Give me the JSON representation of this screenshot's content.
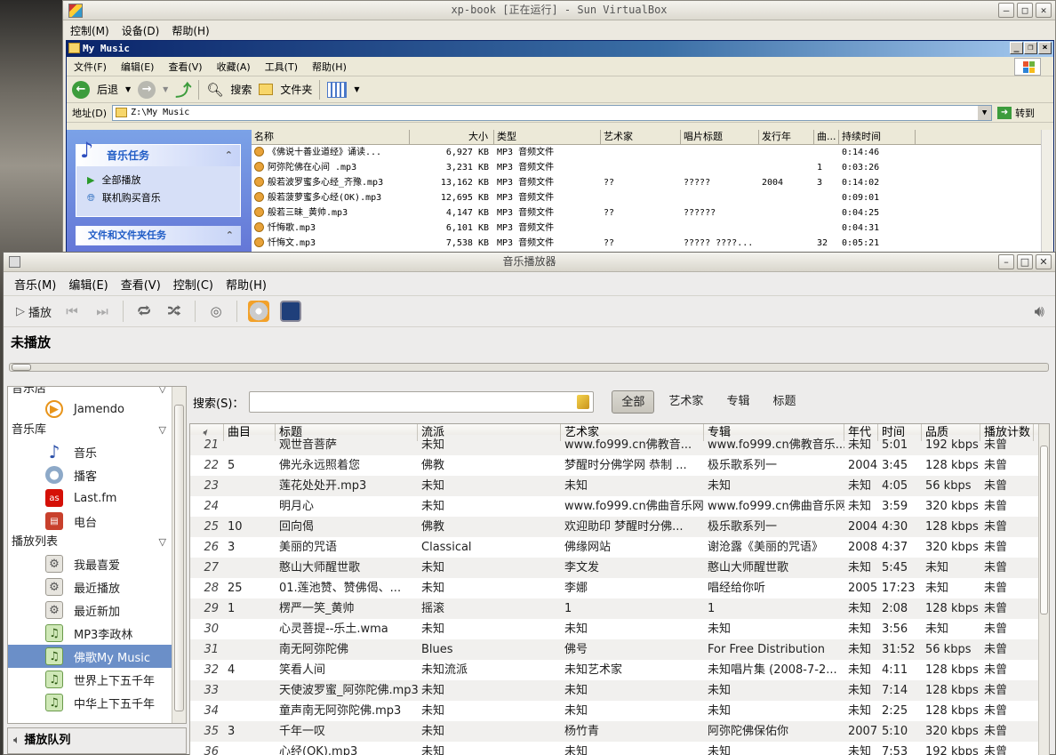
{
  "vbox": {
    "title": "xp-book [正在运行] - Sun VirtualBox",
    "menu": [
      "控制(M)",
      "设备(D)",
      "帮助(H)"
    ]
  },
  "xp": {
    "title": "My Music",
    "menu": [
      "文件(F)",
      "编辑(E)",
      "查看(V)",
      "收藏(A)",
      "工具(T)",
      "帮助(H)"
    ],
    "toolbar": {
      "back": "后退",
      "search": "搜索",
      "folders": "文件夹"
    },
    "address_label": "地址(D)",
    "address": "Z:\\My Music",
    "go": "转到",
    "tasks": {
      "title": "音乐任务",
      "items": [
        "全部播放",
        "联机购买音乐"
      ],
      "file_tasks": "文件和文件夹任务"
    },
    "columns": [
      "名称",
      "大小",
      "类型",
      "艺术家",
      "唱片标题",
      "发行年",
      "曲...",
      "持续时间"
    ],
    "files": [
      {
        "name": "《佛说十善业道经》诵读...",
        "size": "6,927 KB",
        "type": "MP3 音频文件",
        "artist": "",
        "album": "",
        "year": "",
        "track": "",
        "duration": "0:14:46"
      },
      {
        "name": "阿弥陀佛在心间 .mp3",
        "size": "3,231 KB",
        "type": "MP3 音频文件",
        "artist": "",
        "album": "",
        "year": "",
        "track": "1",
        "duration": "0:03:26"
      },
      {
        "name": "般若波罗蜜多心经_齐豫.mp3",
        "size": "13,162 KB",
        "type": "MP3 音频文件",
        "artist": "??",
        "album": "?????",
        "year": "2004",
        "track": "3",
        "duration": "0:14:02"
      },
      {
        "name": "般若菠萝蜜多心经(OK).mp3",
        "size": "12,695 KB",
        "type": "MP3 音频文件",
        "artist": "",
        "album": "",
        "year": "",
        "track": "",
        "duration": "0:09:01"
      },
      {
        "name": "般若三昧_黄帅.mp3",
        "size": "4,147 KB",
        "type": "MP3 音频文件",
        "artist": "??",
        "album": "??????",
        "year": "",
        "track": "",
        "duration": "0:04:25"
      },
      {
        "name": "忏悔歌.mp3",
        "size": "6,101 KB",
        "type": "MP3 音频文件",
        "artist": "",
        "album": "",
        "year": "",
        "track": "",
        "duration": "0:04:31"
      },
      {
        "name": "忏悔文.mp3",
        "size": "7,538 KB",
        "type": "MP3 音频文件",
        "artist": "??",
        "album": "????? ????...",
        "year": "",
        "track": "32",
        "duration": "0:05:21"
      }
    ]
  },
  "player": {
    "title": "音乐播放器",
    "menu": [
      "音乐(M)",
      "编辑(E)",
      "查看(V)",
      "控制(C)",
      "帮助(H)"
    ],
    "play_label": "播放",
    "status": "未播放",
    "sidebar": {
      "top_partial": "音乐店",
      "jamendo": "Jamendo",
      "library": "音乐库",
      "library_items": [
        "音乐",
        "播客",
        "Last.fm",
        "电台"
      ],
      "playlists": "播放列表",
      "playlist_items": [
        "我最喜爱",
        "最近播放",
        "最近新加",
        "MP3李政林",
        "佛歌My Music",
        "世界上下五千年",
        "中华上下五千年"
      ],
      "queue": "播放队列"
    },
    "search_label": "搜索(S)：",
    "filters": [
      "全部",
      "艺术家",
      "专辑",
      "标题"
    ],
    "columns": [
      "曲目",
      "标题",
      "流派",
      "艺术家",
      "专辑",
      "年代",
      "时间",
      "品质",
      "播放计数"
    ],
    "tracks": [
      {
        "n": "21",
        "track": "",
        "title": "观世音菩萨",
        "genre": "未知",
        "artist": "www.fo999.cn佛教音...",
        "album": "www.fo999.cn佛教音乐...",
        "year": "未知",
        "time": "5:01",
        "quality": "192 kbps",
        "plays": "未曾"
      },
      {
        "n": "22",
        "track": "5",
        "title": "佛光永远照着您",
        "genre": "佛教",
        "artist": "梦醒时分佛学网 恭制 ...",
        "album": "极乐歌系列一",
        "year": "2004",
        "time": "3:45",
        "quality": "128 kbps",
        "plays": "未曾"
      },
      {
        "n": "23",
        "track": "",
        "title": "莲花处处开.mp3",
        "genre": "未知",
        "artist": "未知",
        "album": "未知",
        "year": "未知",
        "time": "4:05",
        "quality": "56 kbps",
        "plays": "未曾"
      },
      {
        "n": "24",
        "track": "",
        "title": "明月心",
        "genre": "未知",
        "artist": "www.fo999.cn佛曲音乐网",
        "album": "www.fo999.cn佛曲音乐网",
        "year": "未知",
        "time": "3:59",
        "quality": "320 kbps",
        "plays": "未曾"
      },
      {
        "n": "25",
        "track": "10",
        "title": "回向偈",
        "genre": "佛教",
        "artist": "欢迎助印 梦醒时分佛...",
        "album": "极乐歌系列一",
        "year": "2004",
        "time": "4:30",
        "quality": "128 kbps",
        "plays": "未曾"
      },
      {
        "n": "26",
        "track": "3",
        "title": "美丽的咒语",
        "genre": "Classical",
        "artist": "佛缘网站",
        "album": "谢沧露《美丽的咒语》",
        "year": "2008",
        "time": "4:37",
        "quality": "320 kbps",
        "plays": "未曾"
      },
      {
        "n": "27",
        "track": "",
        "title": "憨山大师醒世歌",
        "genre": "未知",
        "artist": "李文发",
        "album": "憨山大师醒世歌",
        "year": "未知",
        "time": "5:45",
        "quality": "未知",
        "plays": "未曾"
      },
      {
        "n": "28",
        "track": "25",
        "title": "01.莲池赞、赞佛偈、...",
        "genre": "未知",
        "artist": "李娜",
        "album": "唱经给你听",
        "year": "2005",
        "time": "17:23",
        "quality": "未知",
        "plays": "未曾"
      },
      {
        "n": "29",
        "track": "1",
        "title": "楞严一笑_黄帅",
        "genre": "摇滚",
        "artist": "1",
        "album": "1",
        "year": "未知",
        "time": "2:08",
        "quality": "128 kbps",
        "plays": "未曾"
      },
      {
        "n": "30",
        "track": "",
        "title": "心灵菩提--乐土.wma",
        "genre": "未知",
        "artist": "未知",
        "album": "未知",
        "year": "未知",
        "time": "3:56",
        "quality": "未知",
        "plays": "未曾"
      },
      {
        "n": "31",
        "track": "",
        "title": "南无阿弥陀佛",
        "genre": "Blues",
        "artist": "佛号",
        "album": "For Free Distribution",
        "year": "未知",
        "time": "31:52",
        "quality": "56 kbps",
        "plays": "未曾"
      },
      {
        "n": "32",
        "track": "4",
        "title": "笑看人间",
        "genre": "未知流派",
        "artist": "未知艺术家",
        "album": "未知唱片集 (2008-7-2...",
        "year": "未知",
        "time": "4:11",
        "quality": "128 kbps",
        "plays": "未曾"
      },
      {
        "n": "33",
        "track": "",
        "title": "天使波罗蜜_阿弥陀佛.mp3",
        "genre": "未知",
        "artist": "未知",
        "album": "未知",
        "year": "未知",
        "time": "7:14",
        "quality": "128 kbps",
        "plays": "未曾"
      },
      {
        "n": "34",
        "track": "",
        "title": "童声南无阿弥陀佛.mp3",
        "genre": "未知",
        "artist": "未知",
        "album": "未知",
        "year": "未知",
        "time": "2:25",
        "quality": "128 kbps",
        "plays": "未曾"
      },
      {
        "n": "35",
        "track": "3",
        "title": "千年一叹",
        "genre": "未知",
        "artist": "杨竹青",
        "album": "阿弥陀佛保佑你",
        "year": "2007",
        "time": "5:10",
        "quality": "320 kbps",
        "plays": "未曾"
      },
      {
        "n": "36",
        "track": "",
        "title": "心经(OK).mp3",
        "genre": "未知",
        "artist": "未知",
        "album": "未知",
        "year": "未知",
        "time": "7:53",
        "quality": "192 kbps",
        "plays": "未曾"
      }
    ]
  }
}
